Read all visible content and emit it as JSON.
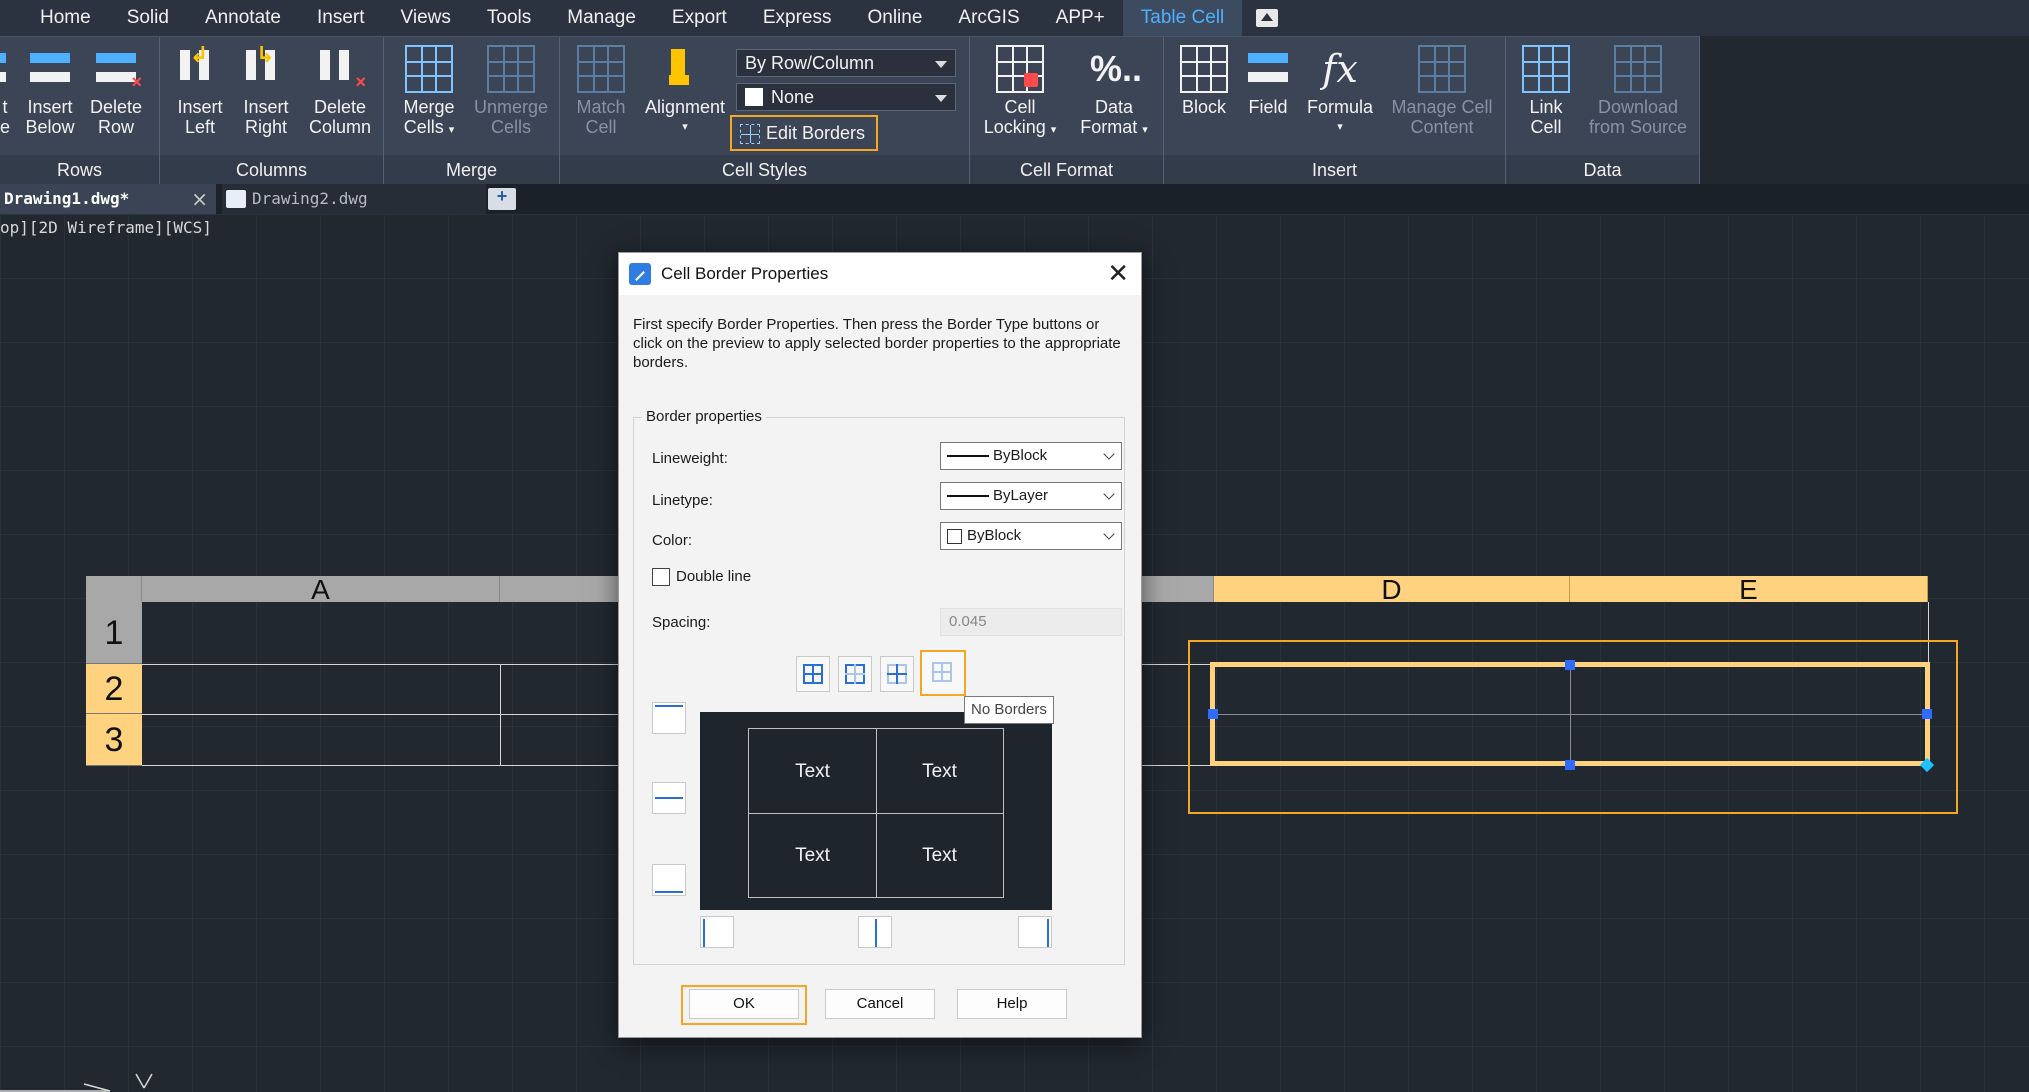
{
  "menubar": {
    "items": [
      "Home",
      "Solid",
      "Annotate",
      "Insert",
      "Views",
      "Tools",
      "Manage",
      "Export",
      "Express",
      "Online",
      "ArcGIS",
      "APP+",
      "Table Cell"
    ]
  },
  "ribbon": {
    "rows_panel": {
      "title": "Rows",
      "insert_above_tail": "t",
      "insert_above_tail2": "e",
      "insert_below": [
        "Insert",
        "Below"
      ],
      "delete_row": [
        "Delete",
        "Row"
      ]
    },
    "columns_panel": {
      "title": "Columns",
      "insert_left": [
        "Insert",
        "Left"
      ],
      "insert_right": [
        "Insert",
        "Right"
      ],
      "delete_column": [
        "Delete",
        "Column"
      ]
    },
    "merge_panel": {
      "title": "Merge",
      "merge_cells": [
        "Merge",
        "Cells"
      ],
      "unmerge_cells": [
        "Unmerge",
        "Cells"
      ]
    },
    "cell_styles_panel": {
      "title": "Cell Styles",
      "match_cell": [
        "Match",
        "Cell"
      ],
      "alignment": "Alignment",
      "style_select": "By Row/Column",
      "fill_select": "None",
      "edit_borders": "Edit Borders"
    },
    "cell_format_panel": {
      "title": "Cell Format",
      "cell_locking": [
        "Cell",
        "Locking"
      ],
      "data_format": [
        "Data",
        "Format"
      ],
      "data_format_icon": "%.."
    },
    "insert_panel": {
      "title": "Insert",
      "block": "Block",
      "field": "Field",
      "formula": "Formula",
      "formula_icon": "fx",
      "manage_cell_content": [
        "Manage Cell",
        "Content"
      ]
    },
    "data_panel": {
      "title": "Data",
      "link_cell": [
        "Link",
        "Cell"
      ],
      "download_from_source": [
        "Download",
        "from Source"
      ]
    }
  },
  "tabs": {
    "active": "Drawing1.dwg*",
    "close_glyph": "×",
    "second": "Drawing2.dwg"
  },
  "viewport_label": "op][2D Wireframe][WCS]",
  "table": {
    "columns": [
      "A",
      "D",
      "E"
    ],
    "rows": [
      "1",
      "2",
      "3"
    ]
  },
  "dialog": {
    "title": "Cell Border Properties",
    "close_glyph": "✕",
    "description": "First specify Border Properties. Then press the Border Type buttons or click on the preview to apply selected border properties to the appropriate borders.",
    "group_title": "Border properties",
    "lineweight_label": "Lineweight:",
    "lineweight_value": "ByBlock",
    "linetype_label": "Linetype:",
    "linetype_value": "ByLayer",
    "color_label": "Color:",
    "color_value": "ByBlock",
    "double_line_label": "Double line",
    "spacing_label": "Spacing:",
    "spacing_value": "0.045",
    "tooltip": "No Borders",
    "preview_cells": [
      "Text",
      "Text",
      "Text",
      "Text"
    ],
    "ok": "OK",
    "cancel": "Cancel",
    "help": "Help"
  },
  "colors": {
    "accent_orange": "#f5a623",
    "selection_yellow": "#ffd27f",
    "active_tab_blue": "#4fb0ff"
  },
  "icons": [
    "shield-icon",
    "grid-icon",
    "close-icon",
    "chevron-down-icon",
    "border-all-icon",
    "border-outside-icon",
    "border-inside-icon",
    "border-none-icon"
  ]
}
